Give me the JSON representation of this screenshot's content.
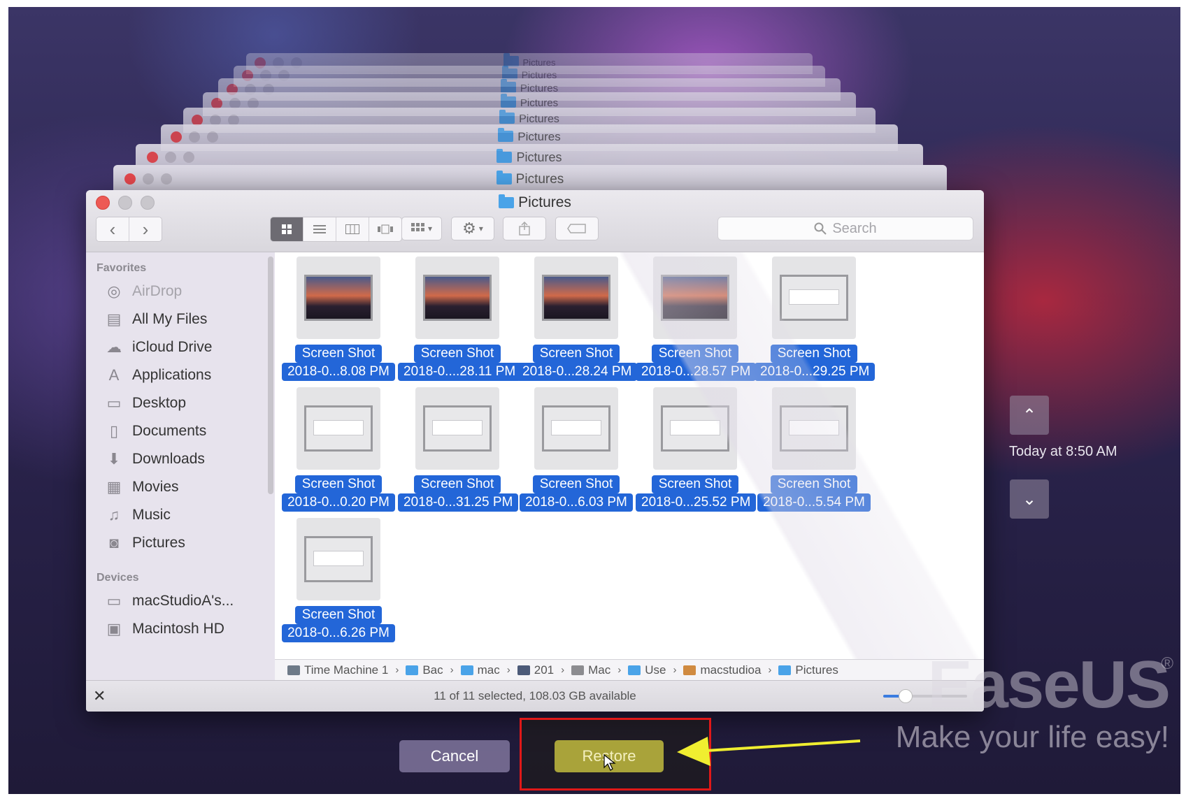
{
  "stack_windows": [
    "Pictures",
    "Pictures",
    "Pictures",
    "Pictures",
    "Pictures",
    "Pictures",
    "Pictures",
    "Pictures"
  ],
  "window": {
    "title": "Pictures"
  },
  "toolbar": {
    "back": "‹",
    "forward": "›",
    "search_placeholder": "Search"
  },
  "sidebar": {
    "favorites_title": "Favorites",
    "favorites": [
      {
        "label": "AirDrop",
        "icon": "airdrop-icon"
      },
      {
        "label": "All My Files",
        "icon": "all-files-icon"
      },
      {
        "label": "iCloud Drive",
        "icon": "cloud-icon"
      },
      {
        "label": "Applications",
        "icon": "applications-icon"
      },
      {
        "label": "Desktop",
        "icon": "desktop-icon"
      },
      {
        "label": "Documents",
        "icon": "documents-icon"
      },
      {
        "label": "Downloads",
        "icon": "downloads-icon"
      },
      {
        "label": "Movies",
        "icon": "movies-icon"
      },
      {
        "label": "Music",
        "icon": "music-icon"
      },
      {
        "label": "Pictures",
        "icon": "camera-icon"
      }
    ],
    "devices_title": "Devices",
    "devices": [
      {
        "label": "macStudioA's...",
        "icon": "laptop-icon"
      },
      {
        "label": "Macintosh HD",
        "icon": "disk-icon"
      }
    ]
  },
  "files": [
    {
      "line1": "Screen Shot",
      "line2": "2018-0...8.08 PM"
    },
    {
      "line1": "Screen Shot",
      "line2": "2018-0....28.11 PM"
    },
    {
      "line1": "Screen Shot",
      "line2": "2018-0...28.24 PM"
    },
    {
      "line1": "Screen Shot",
      "line2": "2018-0...28.57 PM"
    },
    {
      "line1": "Screen Shot",
      "line2": "2018-0...29.25 PM"
    },
    {
      "line1": "Screen Shot",
      "line2": "2018-0...0.20 PM"
    },
    {
      "line1": "Screen Shot",
      "line2": "2018-0...31.25 PM"
    },
    {
      "line1": "Screen Shot",
      "line2": "2018-0...6.03 PM"
    },
    {
      "line1": "Screen Shot",
      "line2": "2018-0...25.52 PM"
    },
    {
      "line1": "Screen Shot",
      "line2": "2018-0...5.54 PM"
    },
    {
      "line1": "Screen Shot",
      "line2": "2018-0...6.26 PM"
    }
  ],
  "path": [
    "Time Machine 1",
    "Bac",
    "mac",
    "201",
    "Mac",
    "Use",
    "macstudioa",
    "Pictures"
  ],
  "status": {
    "text": "11 of 11 selected, 108.03 GB available",
    "close": "✕"
  },
  "timemachine": {
    "up": "⌃",
    "down": "⌄",
    "time": "Today at 8:50 AM"
  },
  "buttons": {
    "cancel": "Cancel",
    "restore": "Restore"
  },
  "watermark": {
    "brand": "EaseUS",
    "registered": "®",
    "tagline": "Make your life easy!"
  },
  "colors": {
    "selection": "#2366d8",
    "restore": "#a9a33a",
    "highlight_box": "#e01818",
    "arrow": "#f0ee30"
  }
}
